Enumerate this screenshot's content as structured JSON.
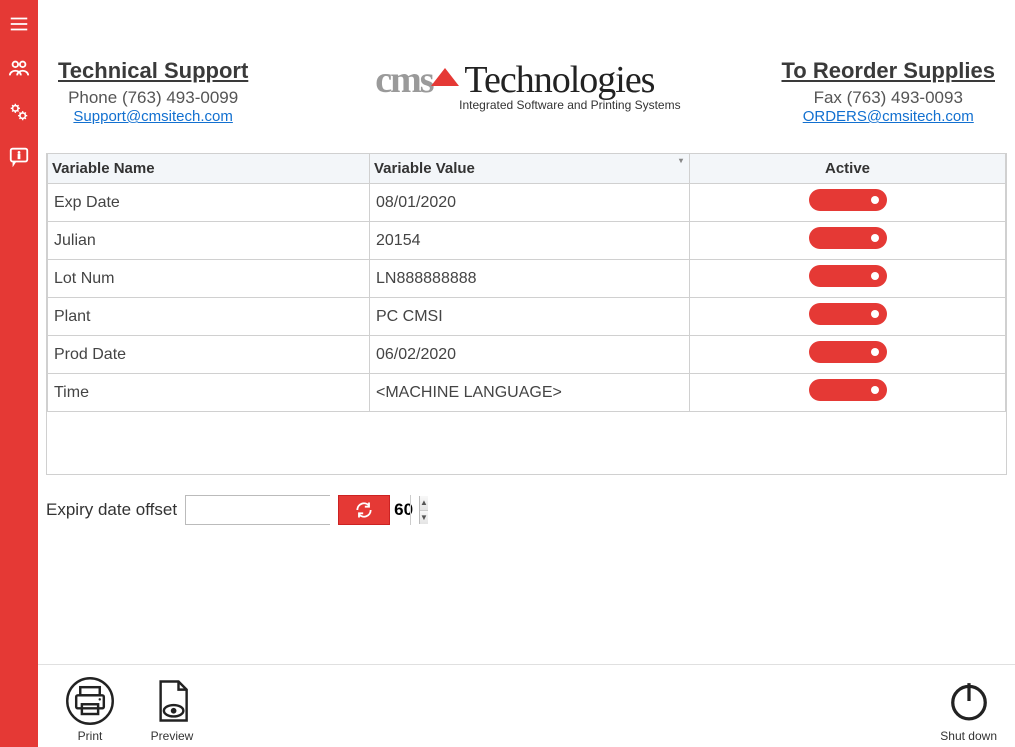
{
  "header": {
    "support": {
      "title": "Technical Support",
      "phone": "Phone (763) 493-0099",
      "email": "Support@cmsitech.com"
    },
    "reorder": {
      "title": "To Reorder Supplies",
      "fax": "Fax (763) 493-0093",
      "email": "ORDERS@cmsitech.com"
    },
    "logo": {
      "brand_left": "cms",
      "brand_right": " Technologies",
      "tagline": "Integrated Software and Printing Systems"
    }
  },
  "table": {
    "headers": {
      "name": "Variable Name",
      "value": "Variable Value",
      "active": "Active"
    },
    "rows": [
      {
        "name": "Exp Date",
        "value": "08/01/2020",
        "active": true
      },
      {
        "name": "Julian",
        "value": "20154",
        "active": true
      },
      {
        "name": "Lot Num",
        "value": "LN888888888",
        "active": true
      },
      {
        "name": "Plant",
        "value": "PC CMSI",
        "active": true
      },
      {
        "name": "Prod Date",
        "value": "06/02/2020",
        "active": true
      },
      {
        "name": "Time",
        "value": "<MACHINE LANGUAGE>",
        "active": true
      }
    ]
  },
  "offset": {
    "label": "Expiry date offset",
    "value": "60"
  },
  "footer": {
    "print": "Print",
    "preview": "Preview",
    "shutdown": "Shut down"
  }
}
